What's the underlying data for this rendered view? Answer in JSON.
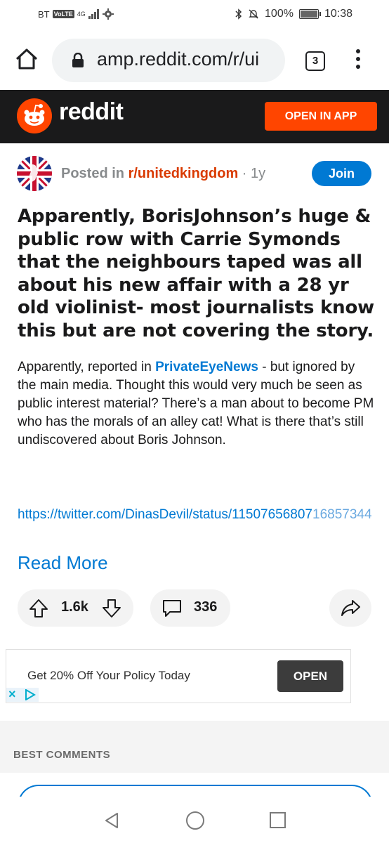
{
  "status_bar": {
    "carrier": "BT",
    "volte": "VoLTE",
    "network": "4G",
    "battery_percent": "100%",
    "time": "10:38"
  },
  "browser": {
    "url": "amp.reddit.com/r/ui",
    "tab_count": "3"
  },
  "header": {
    "wordmark": "reddit",
    "open_in_app": "OPEN IN APP",
    "brand_color": "#ff4500"
  },
  "post": {
    "posted_in_prefix": "Posted in ",
    "subreddit": "r/unitedkingdom",
    "age": " · 1y",
    "join_label": "Join",
    "title": "Apparently, BorisJohnson’s huge & public row with Carrie Symonds that the neighbours taped was all about his new affair with a 28 yr old violinist- most journalists know this but are not covering the story.",
    "body_prefix": "Apparently, reported in ",
    "body_link": "PrivateEyeNews",
    "body_suffix": " - but ignored by the main media. Thought this would very much be seen as public interest material? There’s a man about to become PM who has the morals of an alley cat! What is there that’s still undiscovered about Boris Johnson.",
    "tweet_link_main": "https://twitter.com/DinasDevil/status/11507656807",
    "tweet_link_rest": "16857344",
    "read_more": "Read More",
    "votes": "1.6k",
    "comments": "336"
  },
  "ad": {
    "text": "Get 20% Off Your Policy Today",
    "button": "OPEN"
  },
  "comments_section": {
    "heading": "BEST COMMENTS"
  }
}
